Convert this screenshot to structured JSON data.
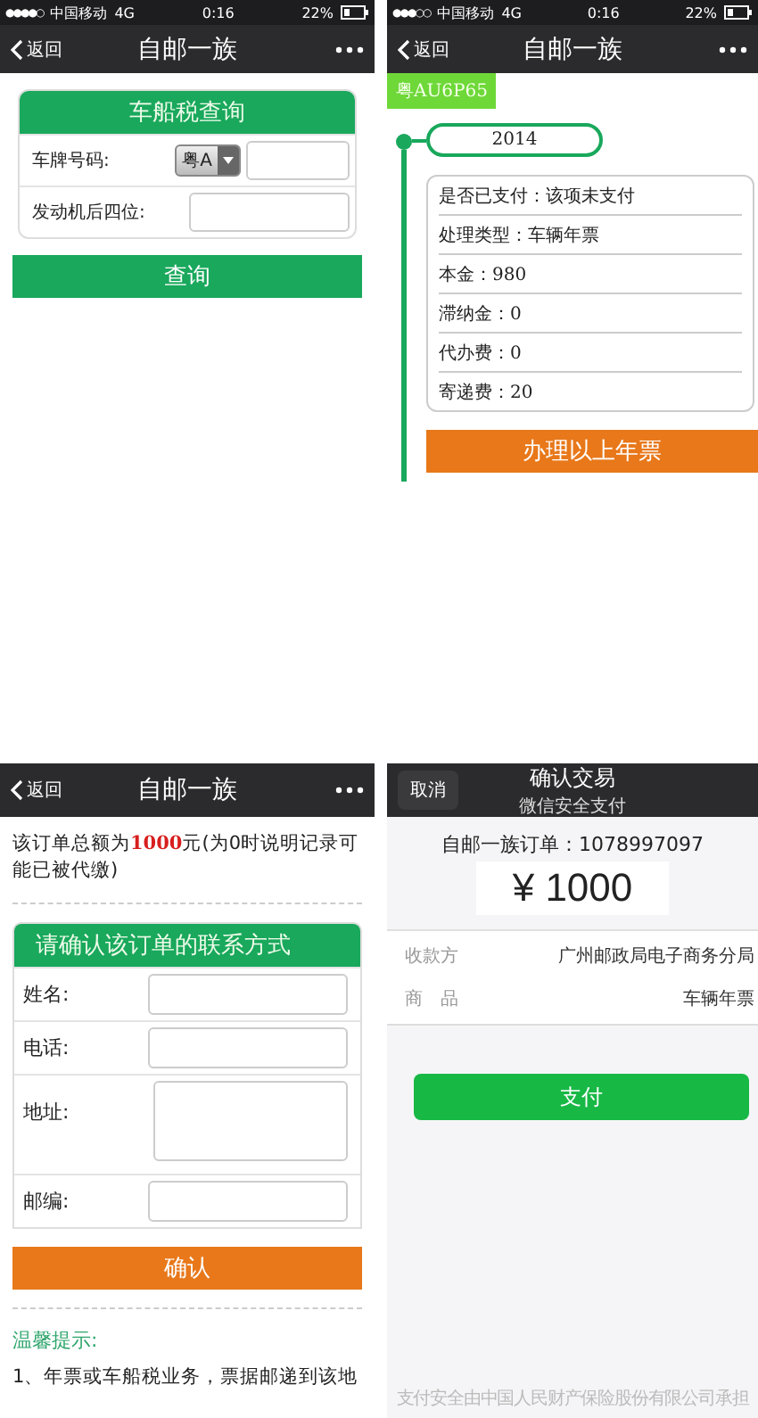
{
  "query_screen": {
    "status_bar": {
      "signal": "●●●●○",
      "carrier": "中国移动",
      "network": "4G",
      "time": "0:16",
      "battery": "22%"
    },
    "nav_bar": {
      "back": "返回",
      "title": "自邮一族"
    },
    "form_title": "车船税查询",
    "fields": [
      {
        "label": "车牌号码:",
        "kind": "plate",
        "province": "粤A"
      },
      {
        "label": "发动机后四位:",
        "kind": "text"
      }
    ],
    "submit": "查询"
  },
  "result_screen": {
    "status_bar": {
      "signal": "●●●○○",
      "carrier": "中国移动",
      "network": "4G",
      "time": "0:16",
      "battery": "22%"
    },
    "nav_bar": {
      "back": "返回",
      "title": "自邮一族"
    },
    "plate": "粤AU6P65",
    "year": "2014",
    "details": [
      "是否已支付：该项未支付",
      "处理类型：车辆年票",
      "本金：980",
      "滞纳金：0",
      "代办费：0",
      "寄递费：20"
    ],
    "action": "办理以上年票"
  },
  "contact_screen": {
    "nav_bar": {
      "back": "返回",
      "title": "自邮一族"
    },
    "total_note": "该订单总额为**1000**元(为0时说明记录可能已被代缴)",
    "form_title": "请确认该订单的联系方式",
    "fields": [
      {
        "label": "姓名:",
        "kind": "text"
      },
      {
        "label": "电话:",
        "kind": "text"
      },
      {
        "label": "地址:",
        "kind": "textarea"
      },
      {
        "label": "邮编:",
        "kind": "text"
      }
    ],
    "confirm": "确认",
    "tips_title": "温馨提示:",
    "tips": [
      "1、年票或车船税业务，票据邮递到该地"
    ]
  },
  "payment_screen": {
    "nav_bar": {
      "cancel": "取消",
      "title": "确认交易",
      "subtitle": "微信安全支付"
    },
    "order": "自邮一族订单：1078997097",
    "amount": "¥ 1000",
    "rows": [
      {
        "label": "收款方",
        "value": "广州邮政局电子商务分局"
      },
      {
        "label": "商　品",
        "value": "车辆年票"
      }
    ],
    "pay": "支付",
    "footer": "支付安全由中国人民财产保险股份有限公司承担"
  }
}
